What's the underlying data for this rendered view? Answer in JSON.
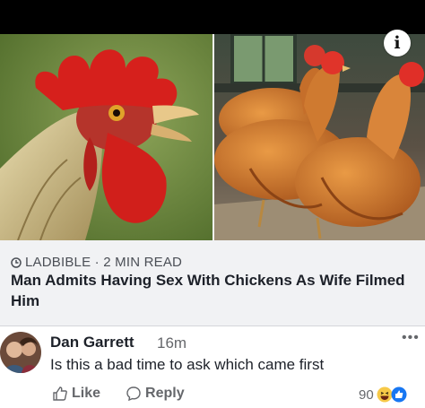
{
  "link_preview": {
    "source": "LADBIBLE · 2 MIN READ",
    "headline": "Man Admits Having Sex With Chickens As Wife Filmed Him"
  },
  "comment": {
    "author": "Dan Garrett",
    "time": "16m",
    "text": "Is this a bad time to ask which came first",
    "like_label": "Like",
    "reply_label": "Reply",
    "reaction_count": "90"
  },
  "icons": {
    "info": "info-icon",
    "more": "more-options-icon",
    "like": "thumbs-up-icon",
    "reply": "reply-bubble-icon",
    "source": "clock-icon"
  },
  "colors": {
    "preview_bg": "#f1f2f4",
    "text_primary": "#1d2129",
    "text_secondary": "#65676b",
    "like_blue": "#1877f2"
  }
}
